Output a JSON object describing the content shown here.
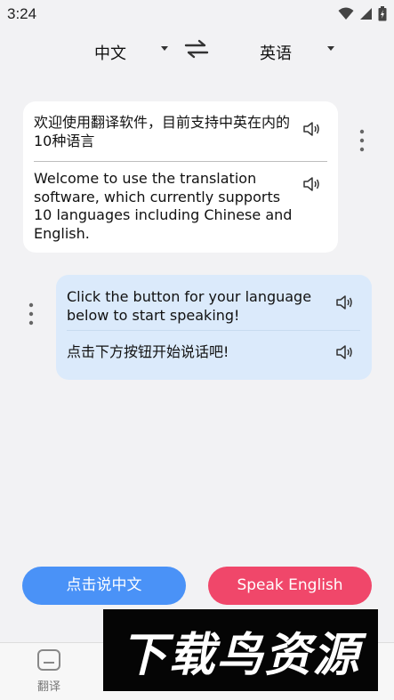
{
  "status_bar": {
    "time": "3:24",
    "icons": [
      "wifi-icon",
      "signal-icon",
      "battery-icon"
    ]
  },
  "languages": {
    "source": "中文",
    "target": "英语"
  },
  "messages": [
    {
      "source_text": "欢迎使用翻译软件，目前支持中英在内的10种语言",
      "translated_text": "Welcome to use the translation software, which currently supports 10 languages including Chinese and English."
    },
    {
      "source_text": "Click the button for your language below to start speaking!",
      "translated_text": "点击下方按钮开始说话吧!"
    }
  ],
  "buttons": {
    "speak_chinese": "点击说中文",
    "speak_english": "Speak English"
  },
  "nav": {
    "items": [
      {
        "label": "翻译",
        "icon": "translate-icon"
      }
    ]
  },
  "watermark": {
    "text": "下载鸟资源"
  },
  "colors": {
    "chinese_button": "#4a92f7",
    "english_button": "#f0476a",
    "blue_card": "#dbeafb"
  }
}
